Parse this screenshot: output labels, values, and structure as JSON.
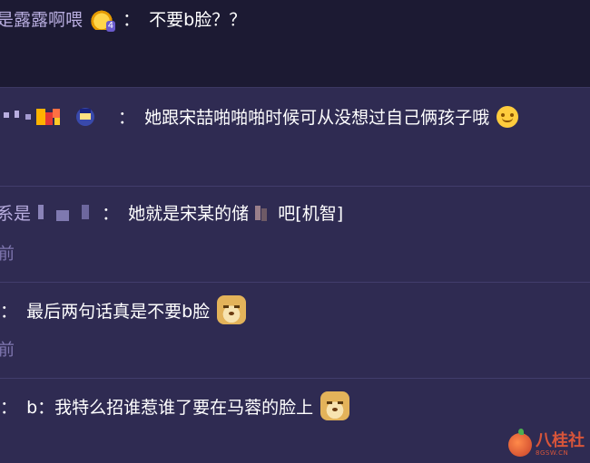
{
  "colors": {
    "background": "#2d2a4a",
    "panel": "#2f2b52",
    "username": "#b9aee0",
    "message": "#ffffff",
    "subtext": "#7f77b0",
    "watermark": "#d8553a"
  },
  "comments": [
    {
      "username": "是露露啊喂",
      "badge": "crown-icon",
      "separator": "：",
      "message": "不要b脸？？"
    },
    {
      "username": "",
      "separator": "：",
      "message": "她跟宋喆啪啪啪时候可从没想过自己俩孩子哦",
      "emoji": "upside-down-face-icon"
    },
    {
      "username": "系是",
      "separator": "：",
      "message": "她就是宋某的储",
      "message_tail": "吧[机智]",
      "sub": "前"
    },
    {
      "separator": "：",
      "message": "最后两句话真是不要b脸",
      "emoji": "doge-icon",
      "sub": "前"
    },
    {
      "separator": "：",
      "message": "b：我特么招谁惹谁了要在马蓉的脸上",
      "emoji": "doge-icon"
    }
  ],
  "watermark": {
    "text": "八桂社",
    "sub": "8GSW.CN"
  }
}
